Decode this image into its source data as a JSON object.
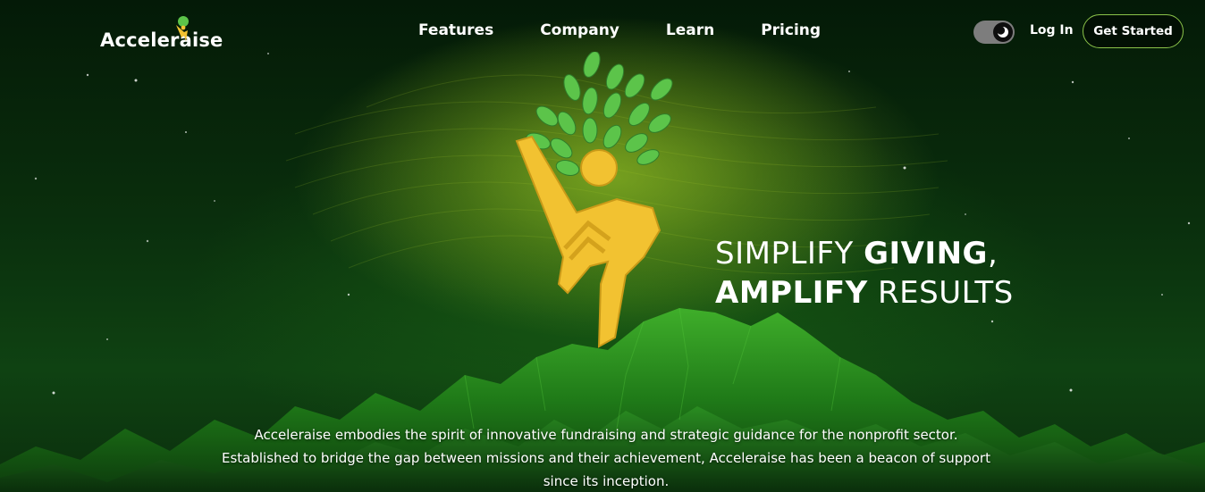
{
  "brand": {
    "name": "Acceleraise",
    "accent_green": "#8bc34a",
    "logo_yellow": "#f2c231",
    "leaf_green": "#5cc44a"
  },
  "nav": {
    "items": [
      {
        "label": "Features"
      },
      {
        "label": "Company"
      },
      {
        "label": "Learn"
      },
      {
        "label": "Pricing"
      }
    ]
  },
  "header": {
    "theme_toggle_icon": "moon-icon",
    "login_label": "Log In",
    "cta_label": "Get Started"
  },
  "hero": {
    "headline_line1_light": "SIMPLIFY",
    "headline_line1_bold": "GIVING",
    "headline_line1_punct": ",",
    "headline_line2_bold": "AMPLIFY",
    "headline_line2_light": "RESULTS",
    "description": "Acceleraise embodies the spirit of innovative fundraising and strategic guidance for the nonprofit sector. Established to bridge the gap between missions and their achievement, Acceleraise has been a beacon of support since its inception."
  }
}
